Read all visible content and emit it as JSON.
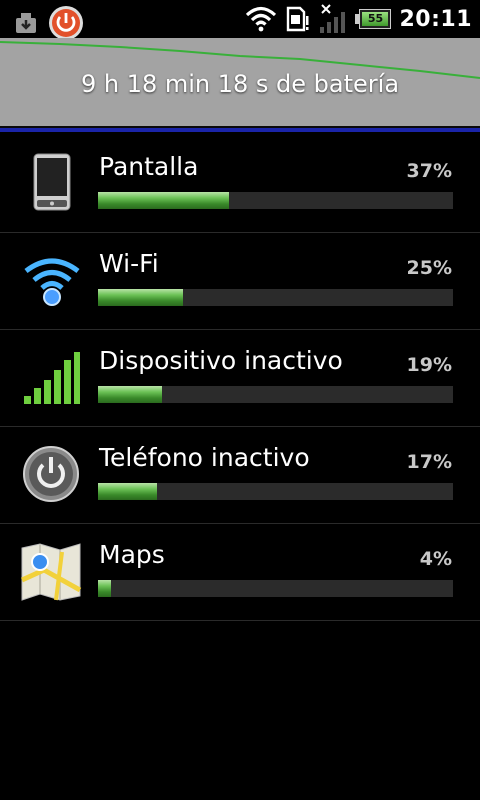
{
  "status_bar": {
    "time": "20:11",
    "battery_level": "55",
    "icons": [
      "download-icon",
      "power-app-icon",
      "wifi-icon",
      "sd-card-icon",
      "no-signal-icon",
      "battery-icon"
    ]
  },
  "header": {
    "battery_time": "9 h 18 min 18 s de batería",
    "colors": {
      "graph_bg": "#a3a3a3",
      "graph_line": "#39b03a",
      "accent_line": "#1a24a8"
    }
  },
  "items": [
    {
      "label": "Pantalla",
      "percent_text": "37%",
      "percent": 37,
      "icon": "phone-screen-icon"
    },
    {
      "label": "Wi-Fi",
      "percent_text": "25%",
      "percent": 25,
      "icon": "wifi-icon"
    },
    {
      "label": "Dispositivo inactivo",
      "percent_text": "19%",
      "percent": 19,
      "icon": "signal-bars-icon"
    },
    {
      "label": "Teléfono inactivo",
      "percent_text": "17%",
      "percent": 17,
      "icon": "power-button-icon"
    },
    {
      "label": "Maps",
      "percent_text": "4%",
      "percent": 4,
      "icon": "maps-icon"
    }
  ]
}
